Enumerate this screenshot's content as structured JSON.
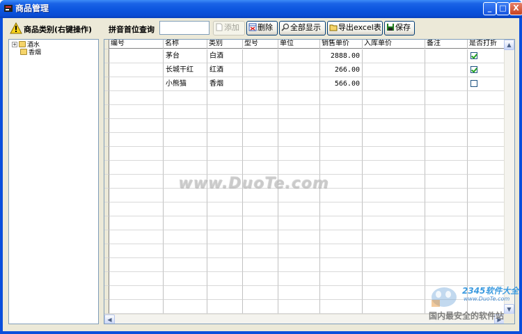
{
  "window": {
    "title": "商品管理",
    "min_glyph": "_",
    "max_glyph": "□",
    "close_glyph": "X"
  },
  "toolbar": {
    "category_label": "商品类别(右键操作)",
    "pinyin_label": "拼音首位查询",
    "pinyin_value": "",
    "add_label": "添加",
    "delete_label": "删除",
    "show_all_label": "全部显示",
    "export_label": "导出excel表",
    "save_label": "保存"
  },
  "tree": {
    "items": [
      {
        "label": "酒水",
        "expandable": true
      },
      {
        "label": "香烟",
        "expandable": false
      }
    ]
  },
  "table": {
    "columns": [
      "编号",
      "名称",
      "类别",
      "型号",
      "单位",
      "销售单价",
      "入库单价",
      "备注",
      "是否打折"
    ],
    "rows": [
      {
        "id": "",
        "name": "茅台",
        "category": "白酒",
        "model": "",
        "unit": "",
        "sale_price": "2888.00",
        "stock_price": "",
        "note": "",
        "discount": true
      },
      {
        "id": "",
        "name": "长城干红",
        "category": "红酒",
        "model": "",
        "unit": "",
        "sale_price": "266.00",
        "stock_price": "",
        "note": "",
        "discount": true
      },
      {
        "id": "",
        "name": "小熊猫",
        "category": "香烟",
        "model": "",
        "unit": "",
        "sale_price": "566.00",
        "stock_price": "",
        "note": "",
        "discount": false
      }
    ]
  },
  "watermark": {
    "text": "www.DuoTe.com",
    "brand": "2345软件大全",
    "brand_url": "www.DuoTe.com",
    "brand_slogan": "国内最安全的软件站"
  },
  "colors": {
    "titlebar": "#0c55de",
    "client_bg": "#ece9d8",
    "border": "#7f9db9"
  }
}
